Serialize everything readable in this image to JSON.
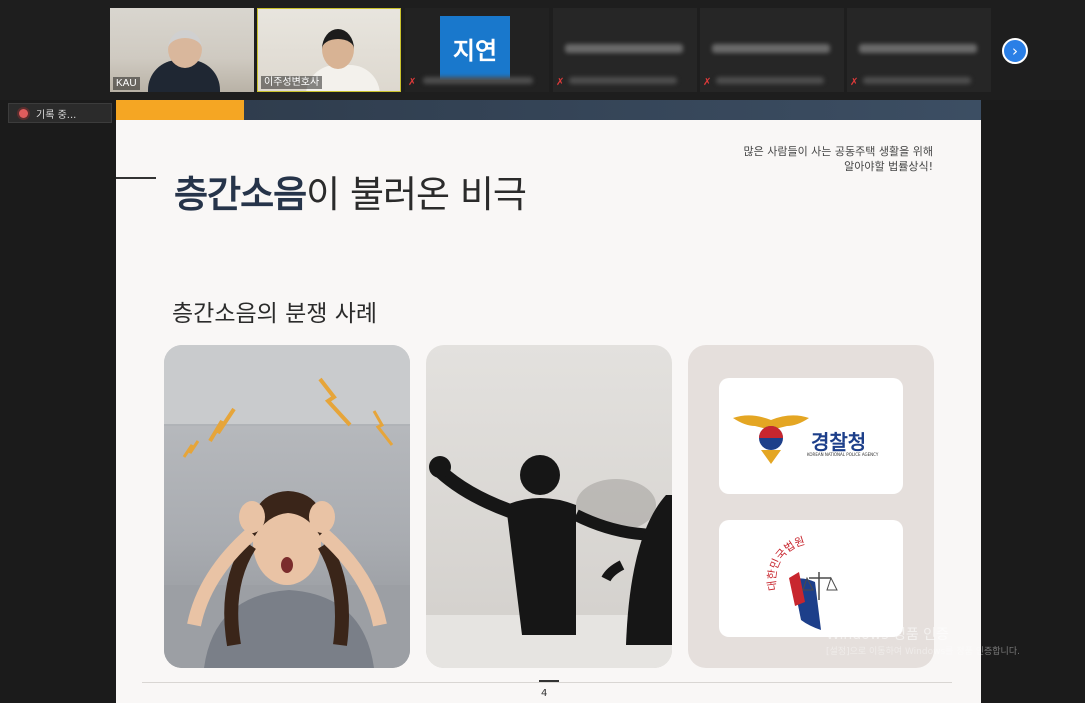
{
  "participants": {
    "cam1_name": "KAU",
    "cam2_name": "이주성변호사",
    "avatar_text": "지연",
    "next_button": "›"
  },
  "recording": {
    "label": "기록 중..."
  },
  "slide": {
    "title_bold": "층간소음",
    "title_rest": "이 불러온 비극",
    "note_line1": "많은 사람들이 사는 공동주택 생활을 위해",
    "note_line2": "알아야할 법률상식!",
    "subtitle": "층간소음의 분쟁 사례",
    "police_logo_text": "경찰청",
    "police_logo_sub": "KOREAN NATIONAL POLICE AGENCY",
    "court_logo_text": "대한민국법원",
    "page_number": "4"
  },
  "watermark": {
    "line1": "Windows 정품 인증",
    "line2": "[설정]으로 이동하여 Windows를 정품 인증합니다."
  },
  "colors": {
    "accent": "#f5a623",
    "title_dark": "#26344a",
    "zoom_blue": "#2a7fe6",
    "avatar_blue": "#1978cc"
  }
}
